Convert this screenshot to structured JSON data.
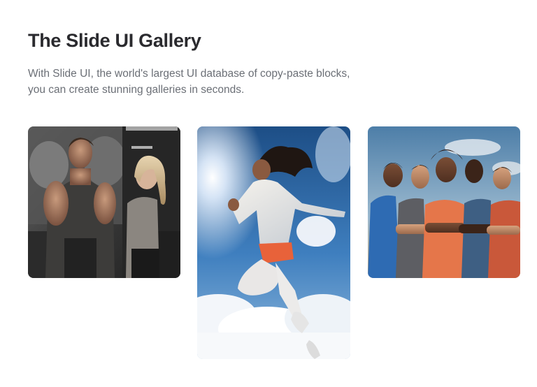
{
  "header": {
    "title": "The Slide UI Gallery",
    "subtitle_line1": "With Slide UI, the world's largest UI database of copy-paste blocks,",
    "subtitle_line2": "you can create stunning galleries in seconds."
  },
  "gallery": {
    "images": [
      {
        "name": "gym-couple-photo",
        "subject": "muscular man and blonde woman in a gym"
      },
      {
        "name": "jumping-runner-photo",
        "subject": "woman leaping in the air against blue sky and clouds"
      },
      {
        "name": "athletes-group-photo",
        "subject": "group of five athletes with arms crossed"
      }
    ]
  },
  "colors": {
    "title": "#2a2a2e",
    "subtitle": "#6b6f76",
    "background": "#ffffff"
  }
}
